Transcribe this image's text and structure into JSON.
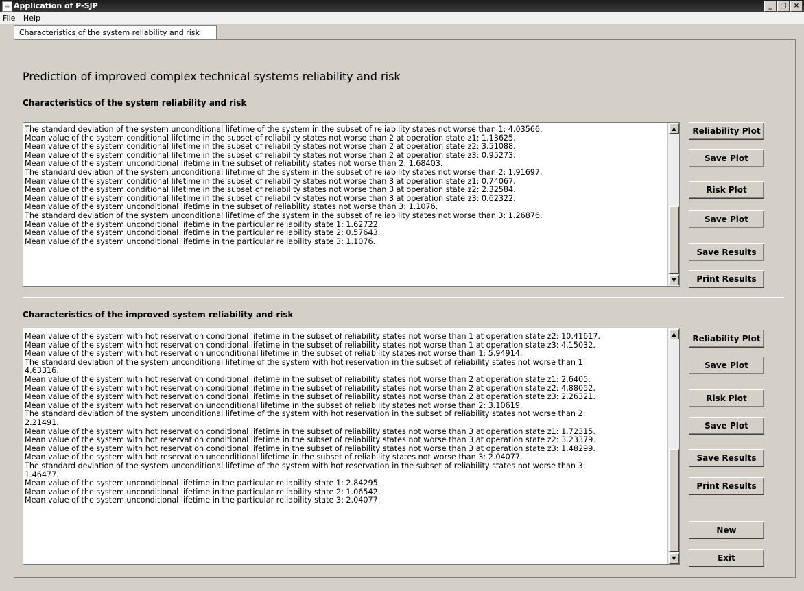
{
  "window": {
    "title": "Application of P-SJP",
    "icons": {
      "app": "coffee-cup-icon",
      "minimize": "minimize-icon",
      "maximize": "maximize-icon",
      "close": "close-icon"
    }
  },
  "menu": {
    "items": [
      "File",
      "Help"
    ]
  },
  "tab": {
    "label": "Characteristics of the system reliability and risk"
  },
  "main": {
    "heading": "Prediction of improved complex technical systems reliability and risk",
    "section1": {
      "title": "Characteristics of the system reliability and risk",
      "lines": [
        "The standard deviation of the system unconditional lifetime of the system in the subset of reliability states not worse than 1: 4.03566.",
        "Mean value of the system conditional lifetime in the subset of reliability states not worse than 2 at operation state z1: 1.13625.",
        "Mean value of the system conditional lifetime in the subset of reliability states not worse than 2 at operation state z2: 3.51088.",
        "Mean value of the system conditional lifetime in the subset of reliability states not worse than 2 at operation state z3: 0.95273.",
        "Mean value of the system unconditional lifetime in the subset of reliability states not worse than 2: 1.68403.",
        "The standard deviation of the system unconditional lifetime of the system in the subset of reliability states not worse than 2: 1.91697.",
        "Mean value of the system conditional lifetime in the subset of reliability states not worse than 3 at operation state z1: 0.74067.",
        "Mean value of the system conditional lifetime in the subset of reliability states not worse than 3 at operation state z2: 2.32584.",
        "Mean value of the system conditional lifetime in the subset of reliability states not worse than 3 at operation state z3: 0.62322.",
        "Mean value of the system unconditional lifetime in the subset of reliability states not worse than 3: 1.1076.",
        "The standard deviation of the system unconditional lifetime of the system in the subset of reliability states not worse than 3: 1.26876.",
        "Mean value of the system unconditional lifetime in the particular reliability state 1: 1.62722.",
        "Mean value of the system unconditional lifetime in the particular reliability state 2: 0.57643.",
        "Mean value of the system unconditional lifetime in the particular reliability state 3: 1.1076."
      ],
      "buttons": [
        "Reliability Plot",
        "Save Plot",
        "Risk Plot",
        "Save Plot",
        "Save Results",
        "Print Results"
      ]
    },
    "section2": {
      "title": "Characteristics of the improved system reliability and risk",
      "lines": [
        "Mean value of the system with hot reservation conditional lifetime in the subset of reliability states not worse than 1 at operation state z2: 10.41617.",
        "Mean value of the system with hot reservation conditional lifetime in the subset of reliability states not worse than 1 at operation state z3: 4.15032.",
        "Mean value of the system with hot reservation unconditional lifetime in the subset of reliability states not worse than 1: 5.94914.",
        "The standard deviation of the system unconditional lifetime of the system with hot reservation in the subset of reliability states not worse than 1:",
        "4.63316.",
        "Mean value of the system with hot reservation conditional lifetime in the subset of reliability states not worse than 2 at operation state z1: 2.6405.",
        "Mean value of the system with hot reservation conditional lifetime in the subset of reliability states not worse than 2 at operation state z2: 4.88052.",
        "Mean value of the system with hot reservation conditional lifetime in the subset of reliability states not worse than 2 at operation state z3: 2.26321.",
        "Mean value of the system with hot reservation unconditional lifetime in the subset of reliability states not worse than 2: 3.10619.",
        "The standard deviation of the system unconditional lifetime of the system with hot reservation in the subset of reliability states not worse than 2:",
        "2.21491.",
        "Mean value of the system with hot reservation conditional lifetime in the subset of reliability states not worse than 3 at operation state z1: 1.72315.",
        "Mean value of the system with hot reservation conditional lifetime in the subset of reliability states not worse than 3 at operation state z2: 3.23379.",
        "Mean value of the system with hot reservation conditional lifetime in the subset of reliability states not worse than 3 at operation state z3: 1.48299.",
        "Mean value of the system with hot reservation unconditional lifetime in the subset of reliability states not worse than 3: 2.04077.",
        "The standard deviation of the system unconditional lifetime of the system with hot reservation in the subset of reliability states not worse than 3:",
        "1.46477.",
        "Mean value of the system unconditional lifetime in the particular reliability state 1: 2.84295.",
        "Mean value of the system unconditional lifetime in the particular reliability state 2: 1.06542.",
        "Mean value of the system unconditional lifetime in the particular reliability state 3: 2.04077."
      ],
      "buttons": [
        "Reliability Plot",
        "Save Plot",
        "Risk Plot",
        "Save Plot",
        "Save Results",
        "Print Results",
        "New",
        "Exit"
      ]
    }
  }
}
